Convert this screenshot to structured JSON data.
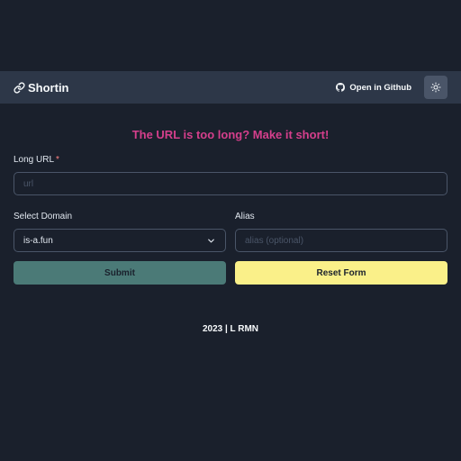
{
  "navbar": {
    "brand": "Shortin",
    "brand_icon": "link-icon",
    "github_label": "Open in Github",
    "github_icon": "github-icon",
    "theme_icon": "sun-icon"
  },
  "main": {
    "heading": "The URL is too long? Make it short!",
    "long_url": {
      "label": "Long URL",
      "required_mark": "*",
      "placeholder": "url"
    },
    "domain": {
      "label": "Select Domain",
      "selected": "is-a.fun"
    },
    "alias": {
      "label": "Alias",
      "placeholder": "alias (optional)"
    },
    "submit_label": "Submit",
    "reset_label": "Reset Form"
  },
  "footer": {
    "text": "2023 | L RMN"
  },
  "colors": {
    "background": "#1a202c",
    "navbar": "#2d3748",
    "heading": "#d53f8c",
    "submit": "#4b7a77",
    "reset": "#faf089"
  }
}
